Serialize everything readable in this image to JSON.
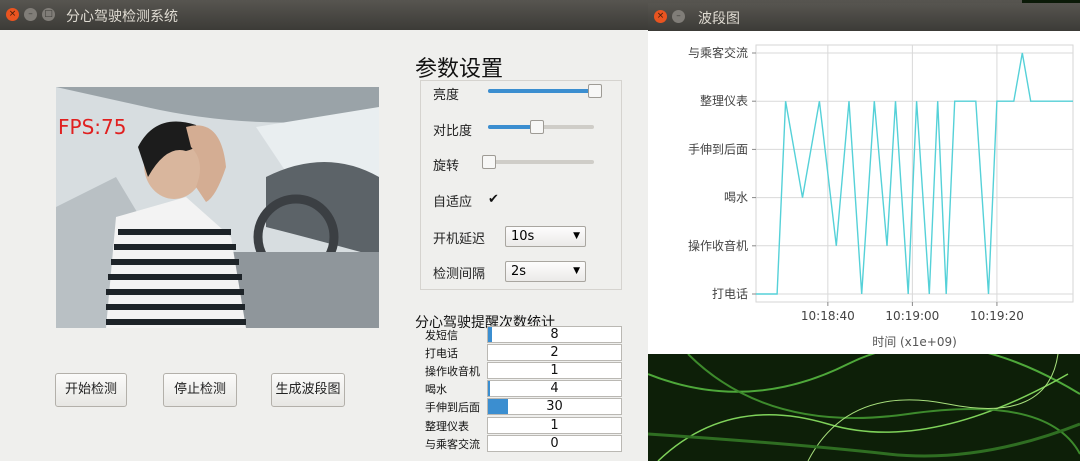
{
  "main_window": {
    "title": "分心驾驶检测系统",
    "camera": {
      "fps_text": "FPS:75"
    },
    "buttons": {
      "start": "开始检测",
      "stop": "停止检测",
      "generate": "生成波段图"
    }
  },
  "params": {
    "title": "参数设置",
    "brightness": {
      "label": "亮度",
      "value": 1.0
    },
    "contrast": {
      "label": "对比度",
      "value": 0.45
    },
    "rotation": {
      "label": "旋转",
      "value": 0.0
    },
    "adaptive": {
      "label": "自适应",
      "checked": true,
      "mark": "✔"
    },
    "boot_delay": {
      "label": "开机延迟",
      "value": "10s"
    },
    "interval": {
      "label": "检测间隔",
      "value": "2s"
    }
  },
  "stats": {
    "title": "分心驾驶提醒次数统计",
    "rows": [
      {
        "label": "发短信",
        "value": "8",
        "fill": 0.03
      },
      {
        "label": "打电话",
        "value": "2",
        "fill": 0
      },
      {
        "label": "操作收音机",
        "value": "1",
        "fill": 0
      },
      {
        "label": "喝水",
        "value": "4",
        "fill": 0.015
      },
      {
        "label": "手伸到后面",
        "value": "30",
        "fill": 0.15
      },
      {
        "label": "整理仪表",
        "value": "1",
        "fill": 0
      },
      {
        "label": "与乘客交流",
        "value": "0",
        "fill": 0
      }
    ]
  },
  "chart_window": {
    "title": "波段图"
  },
  "chart_data": {
    "type": "line",
    "xlabel": "时间 (x1e+09)",
    "x_tick_labels": [
      "10:18:40",
      "10:19:00",
      "10:19:20"
    ],
    "x_ticks": [
      40,
      60,
      80
    ],
    "xlim": [
      23,
      98
    ],
    "y_categories": [
      "打电话",
      "操作收音机",
      "喝水",
      "手伸到后面",
      "整理仪表",
      "与乘客交流"
    ],
    "series": [
      {
        "color": "#55d1d8",
        "x": [
          23,
          28,
          30,
          34,
          38,
          42,
          45,
          48,
          51,
          54,
          56,
          59,
          61,
          64,
          66,
          68,
          70,
          72,
          75,
          78,
          80,
          81,
          84,
          86,
          88,
          91,
          93,
          98
        ],
        "y": [
          0,
          0,
          4,
          2,
          4,
          1,
          4,
          0,
          4,
          1,
          4,
          0,
          4,
          0,
          4,
          0,
          4,
          4,
          4,
          0,
          4,
          4,
          4,
          5,
          4,
          4,
          4,
          4
        ]
      }
    ],
    "grid": true
  },
  "colors": {
    "accent": "#3b8ed0",
    "close_button": "#e95420",
    "line": "#55d1d8",
    "fps_text": "#e02020"
  },
  "icons": {
    "close": "close-icon",
    "minimize": "minimize-icon",
    "maximize": "maximize-icon"
  }
}
